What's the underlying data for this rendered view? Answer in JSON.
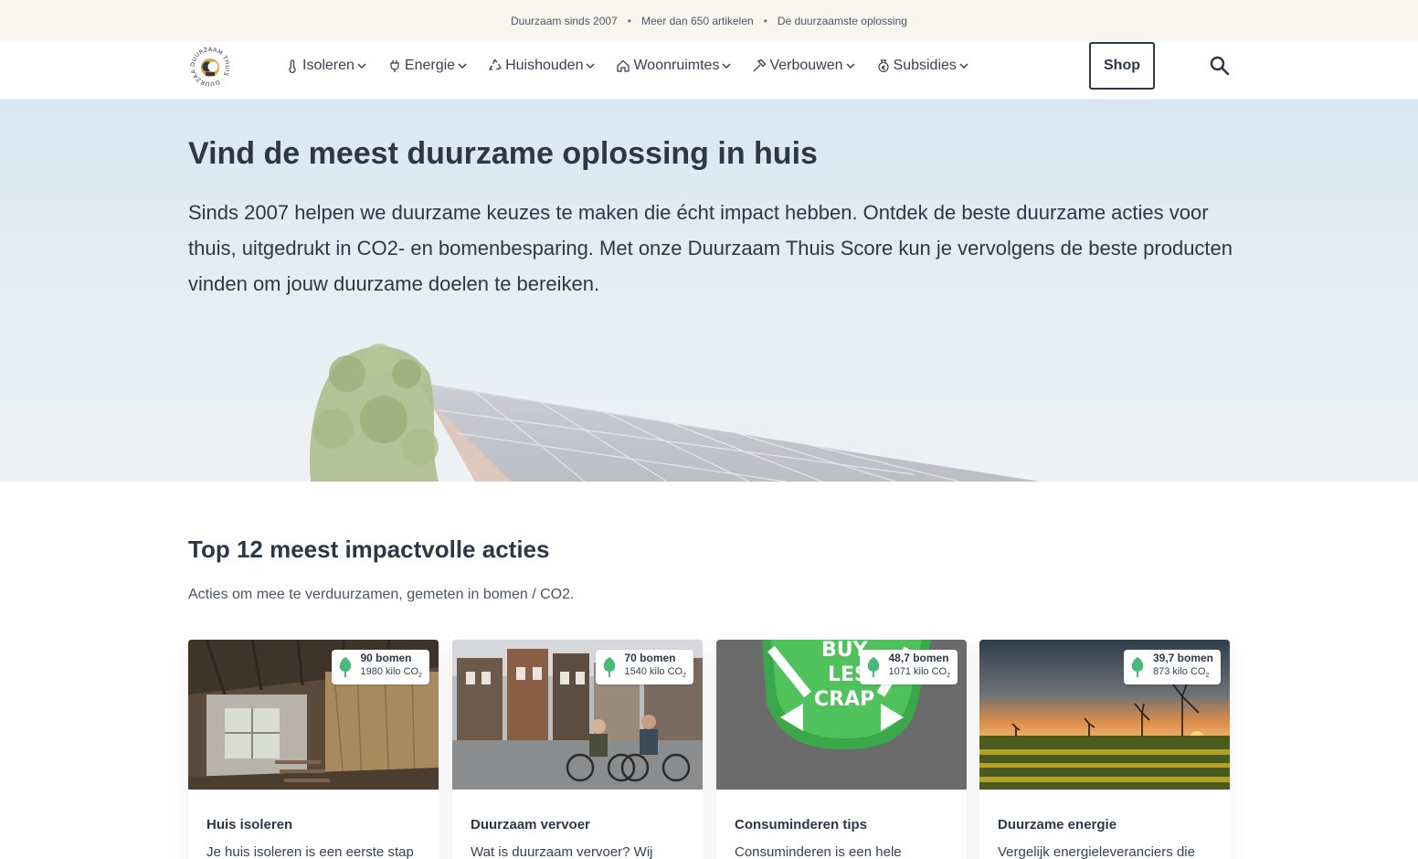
{
  "topbar": {
    "items": [
      "Duurzaam sinds 2007",
      "Meer dan 650 artikelen",
      "De duurzaamste oplossing"
    ],
    "separator": "•"
  },
  "header": {
    "logo_text": "DUURZAAM THUIS",
    "nav": [
      {
        "label": "Isoleren",
        "icon": "thermometer-icon"
      },
      {
        "label": "Energie",
        "icon": "plug-icon"
      },
      {
        "label": "Huishouden",
        "icon": "recycle-icon"
      },
      {
        "label": "Woonruimtes",
        "icon": "house-icon"
      },
      {
        "label": "Verbouwen",
        "icon": "hammer-icon"
      },
      {
        "label": "Subsidies",
        "icon": "euro-bag-icon"
      }
    ],
    "shop_label": "Shop",
    "search_icon": "search-icon"
  },
  "hero": {
    "title": "Vind de meest duurzame oplossing in huis",
    "text": "Sinds 2007 helpen we duurzame keuzes te maken die écht impact hebben. Ontdek de beste duurzame acties voor thuis, uitgedrukt in CO2- en bomenbesparing. Met onze Duurzaam Thuis Score kun je vervolgens de beste producten vinden om jouw duurzame doelen te bereiken."
  },
  "section": {
    "title": "Top 12 meest impactvolle acties",
    "subtitle": "Acties om mee te verduurzamen, gemeten in bomen / CO2."
  },
  "cards": [
    {
      "title": "Huis isoleren",
      "text": "Je huis isoleren is een eerste stap",
      "trees": "90 bomen",
      "co2": "1980 kilo CO",
      "co2_sub": "2"
    },
    {
      "title": "Duurzaam vervoer",
      "text": "Wat is duurzaam vervoer? Wij",
      "trees": "70 bomen",
      "co2": "1540 kilo CO",
      "co2_sub": "2"
    },
    {
      "title": "Consuminderen tips",
      "text": "Consuminderen is een hele",
      "trees": "48,7 bomen",
      "co2": "1071 kilo CO",
      "co2_sub": "2"
    },
    {
      "title": "Duurzame energie",
      "text": "Vergelijk energieleveranciers die",
      "trees": "39,7 bomen",
      "co2": "873 kilo CO",
      "co2_sub": "2"
    }
  ],
  "colors": {
    "text": "#2d3748",
    "topbar_bg": "#f8f6ee",
    "tree_green": "#48bb78",
    "logo_orange": "#e0a33a"
  }
}
